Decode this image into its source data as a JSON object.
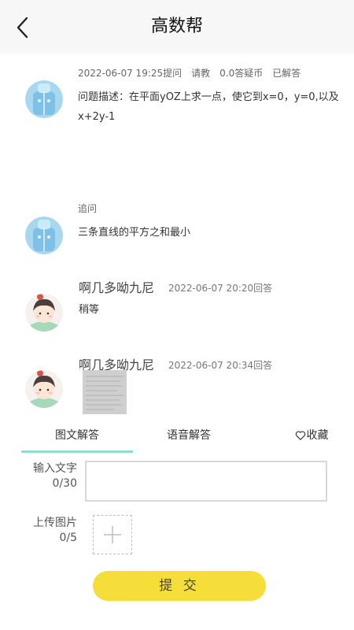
{
  "header": {
    "title": "高数帮"
  },
  "question": {
    "date": "2022-06-07 19:25提问",
    "subject": "请教",
    "reward": "0.0答疑币",
    "status": "已解答",
    "line1": "问题描述：在平面yOZ上求一点，使它到x=0，y=0,以及",
    "line2": "x+2y-1"
  },
  "followup": {
    "label": "追问",
    "text": "三条直线的平方之和最小"
  },
  "answers": [
    {
      "name": "啊几多呦九尼",
      "time": "2022-06-07 20:20回答",
      "text": "稍等"
    },
    {
      "name": "啊几多呦九尼",
      "time": "2022-06-07 20:34回答"
    }
  ],
  "tabs": {
    "image_text": "图文解答",
    "voice": "语音解答",
    "favorite": "收藏"
  },
  "form": {
    "text_label": "输入文字",
    "text_count": "0/30",
    "text_value": "",
    "image_label": "上传图片",
    "image_count": "0/5",
    "submit": "提 交"
  },
  "colors": {
    "header_bg": "#f7f7f7",
    "tab_underline": "#8fdcd4",
    "submit_bg": "#f5dd3a",
    "avatar_blue": "#9fd3ee"
  },
  "icons": [
    "back-arrow-icon",
    "heart-outline-icon",
    "plus-icon"
  ]
}
